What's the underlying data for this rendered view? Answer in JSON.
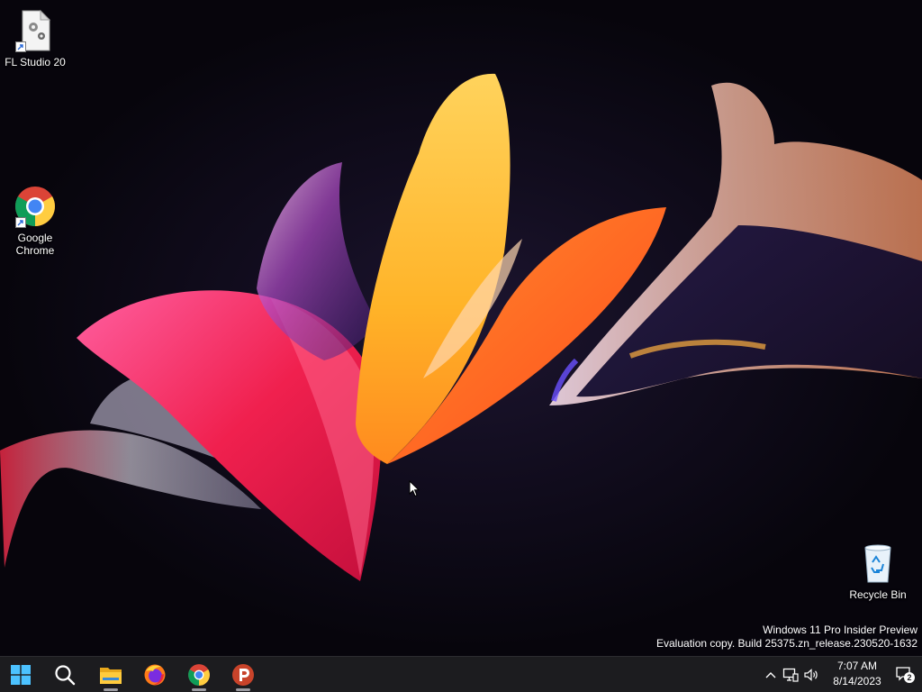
{
  "desktop": {
    "icons": [
      {
        "label": "FL Studio 20",
        "icon": "fl-studio-icon"
      },
      {
        "label": "Google Chrome",
        "icon": "chrome-icon"
      },
      {
        "label": "Recycle Bin",
        "icon": "recycle-bin-icon"
      }
    ],
    "watermark": {
      "line1": "Windows 11 Pro Insider Preview",
      "line2": "Evaluation copy. Build 25375.zn_release.230520-1632"
    }
  },
  "taskbar": {
    "pinned": [
      {
        "icon": "windows-start-icon"
      },
      {
        "icon": "search-icon"
      },
      {
        "icon": "file-explorer-icon"
      },
      {
        "icon": "firefox-icon"
      },
      {
        "icon": "chrome-icon"
      },
      {
        "icon": "psiphon-icon"
      }
    ],
    "tray": {
      "time": "7:07 AM",
      "date": "8/14/2023",
      "notification_count": "2"
    }
  },
  "colors": {
    "taskbar_bg": "#1c1c1f",
    "accent_blue": "#4cc2ff",
    "running_indicator": "#9a9aa0"
  }
}
